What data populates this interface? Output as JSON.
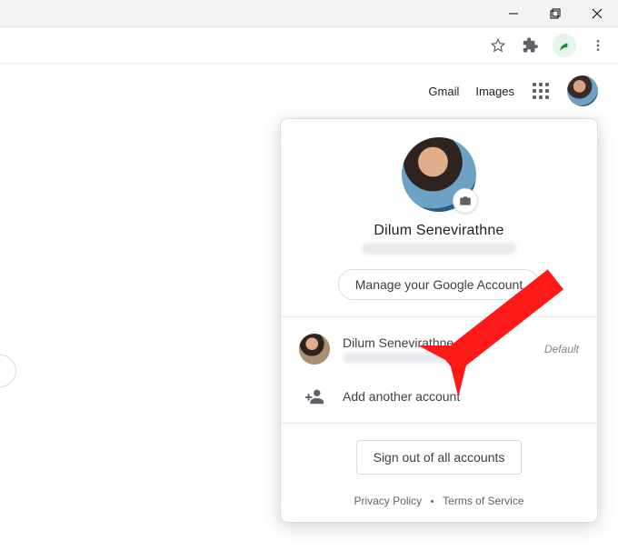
{
  "header": {
    "gmail": "Gmail",
    "images": "Images"
  },
  "popup": {
    "name": "Dilum Senevirathne",
    "manage": "Manage your Google Account",
    "accounts": [
      {
        "name": "Dilum Senevirathne",
        "badge": "Default"
      }
    ],
    "add_account": "Add another account",
    "signout": "Sign out of all accounts",
    "footer": {
      "privacy": "Privacy Policy",
      "terms": "Terms of Service"
    }
  }
}
